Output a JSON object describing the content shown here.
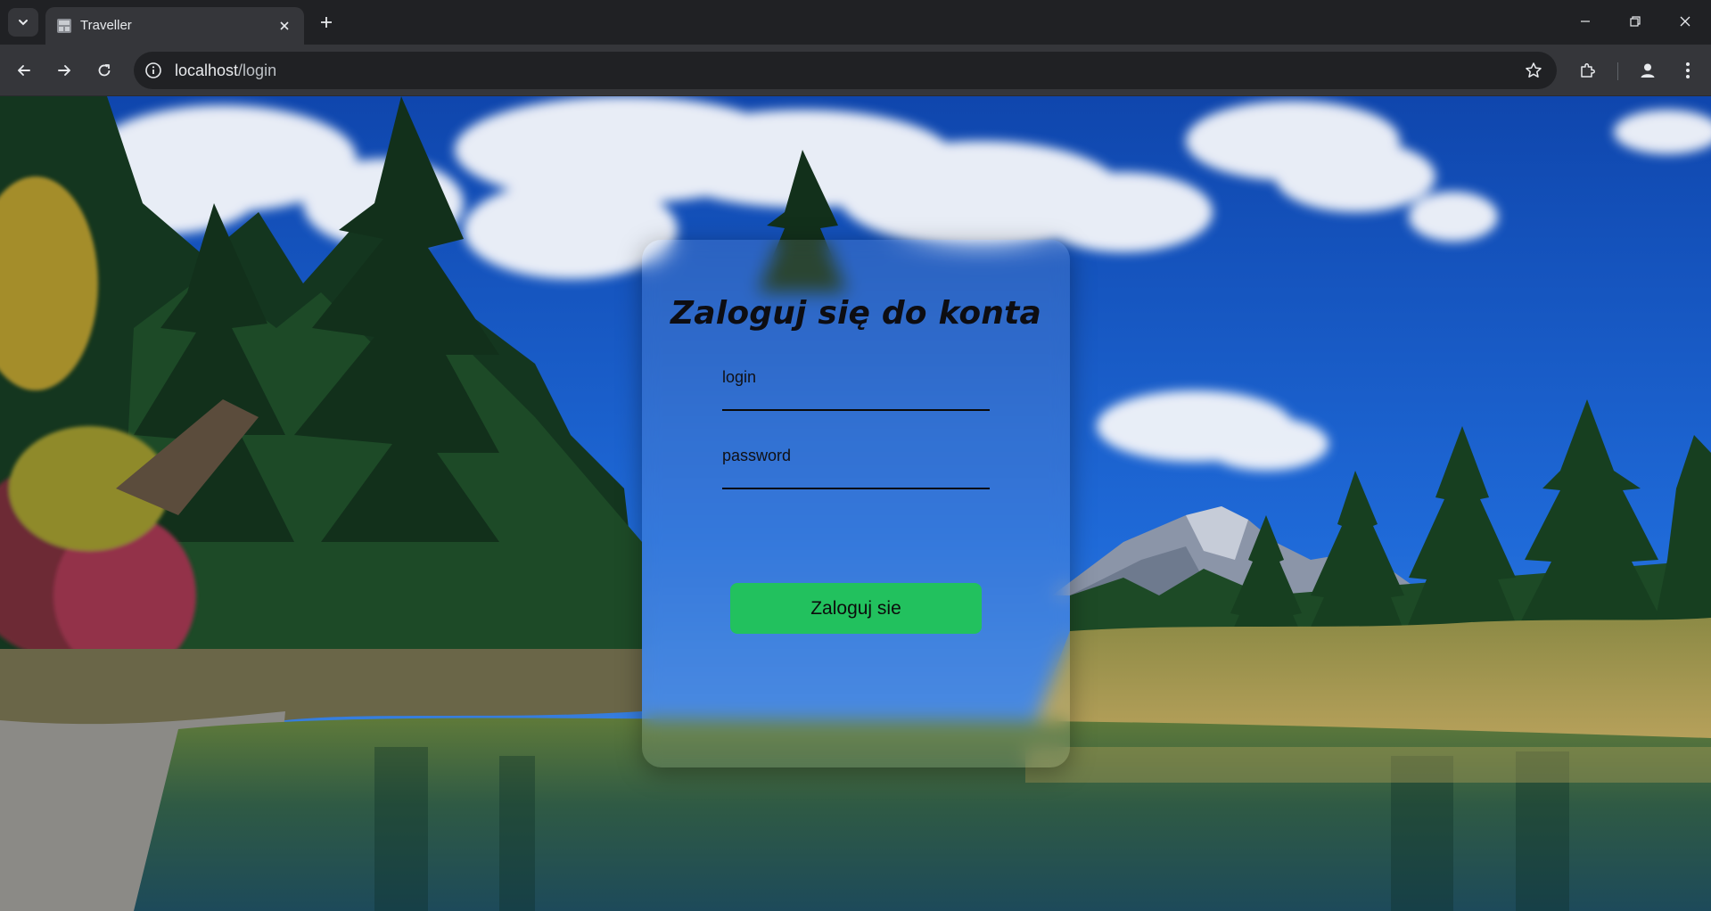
{
  "browser": {
    "tab_title": "Traveller",
    "url_host": "localhost",
    "url_path": "/login"
  },
  "icons": {
    "tab_search": "chevron-down-icon",
    "favicon": "page-favicon",
    "tab_close": "close-icon",
    "new_tab": "plus-icon",
    "minimize": "minimize-icon",
    "restore": "restore-icon",
    "close_window": "close-icon",
    "back": "arrow-left-icon",
    "forward": "arrow-right-icon",
    "reload": "reload-icon",
    "site_info": "info-icon",
    "bookmark": "star-icon",
    "extensions": "puzzle-icon",
    "profile": "person-icon",
    "menu": "kebab-menu-icon"
  },
  "login": {
    "title": "Zaloguj się do konta",
    "login_label": "login",
    "login_value": "",
    "password_label": "password",
    "password_value": "",
    "submit_label": "Zaloguj sie"
  },
  "colors": {
    "chrome_dark": "#202124",
    "chrome_toolbar": "#35363a",
    "button_green": "#22c15e",
    "sky_blue": "#1f5fc8"
  }
}
